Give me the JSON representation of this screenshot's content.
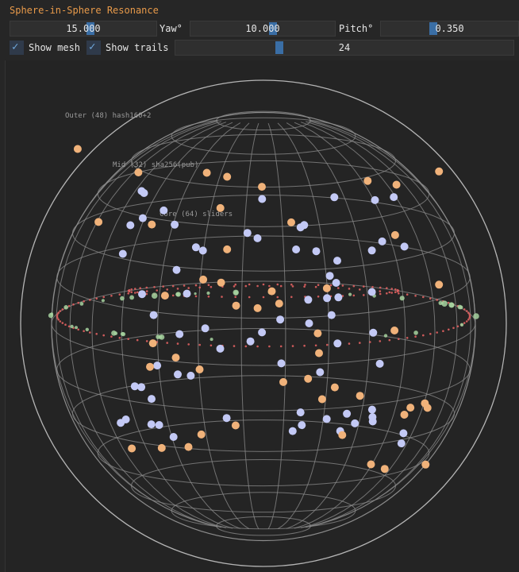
{
  "window": {
    "title": "Sphere-in-Sphere Resonance"
  },
  "controls": {
    "first_value": "15.000",
    "yaw_label": "Yaw°",
    "yaw_value": "10.000",
    "pitch_label": "Pitch°",
    "pitch_value": "0.350",
    "show_mesh_label": "Show mesh",
    "show_mesh_checked": true,
    "show_trails_label": "Show trails",
    "show_trails_checked": true,
    "count_value": "24"
  },
  "scene": {
    "label_outer": "Outer (48) hash160+2",
    "label_mid": "Mid (32) sha256(pub)",
    "label_core": "Core (64) sliders",
    "colors": {
      "outer": "#f0b27a",
      "mid": "#c3c9f5",
      "core": "#a7d3a0",
      "trail": "#e06060",
      "mesh": "#8c8c8c",
      "bg": "#242424"
    }
  }
}
